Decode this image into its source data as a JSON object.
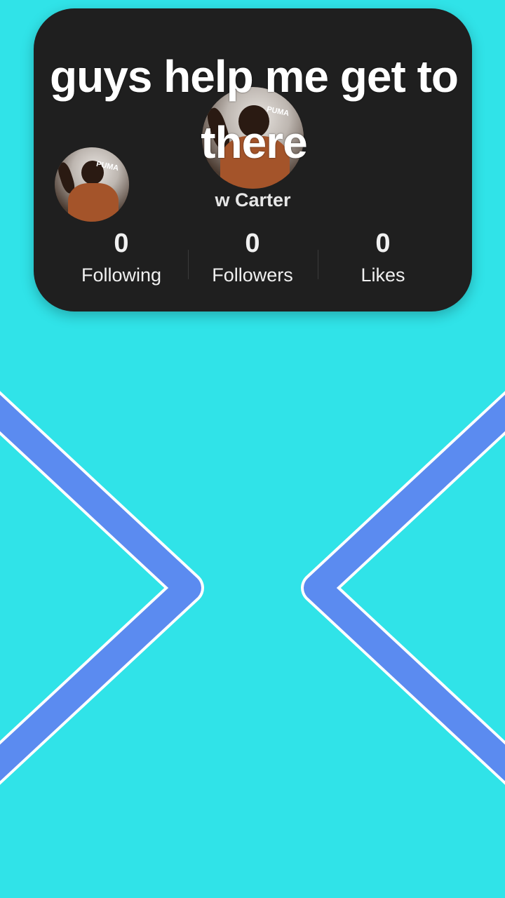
{
  "profile_card": {
    "caption": "guys help me get to there",
    "username": "w Carter",
    "stats": [
      {
        "value": "0",
        "label": "Following"
      },
      {
        "value": "0",
        "label": "Followers"
      },
      {
        "value": "0",
        "label": "Likes"
      }
    ],
    "avatar_brand": "PUMA"
  },
  "decor": {
    "background_color": "#30e3e8",
    "chevron_color": "#5b8bf0",
    "chevron_outline": "#ffffff",
    "left_shape": "chevron-right-icon",
    "right_shape": "chevron-left-icon"
  }
}
